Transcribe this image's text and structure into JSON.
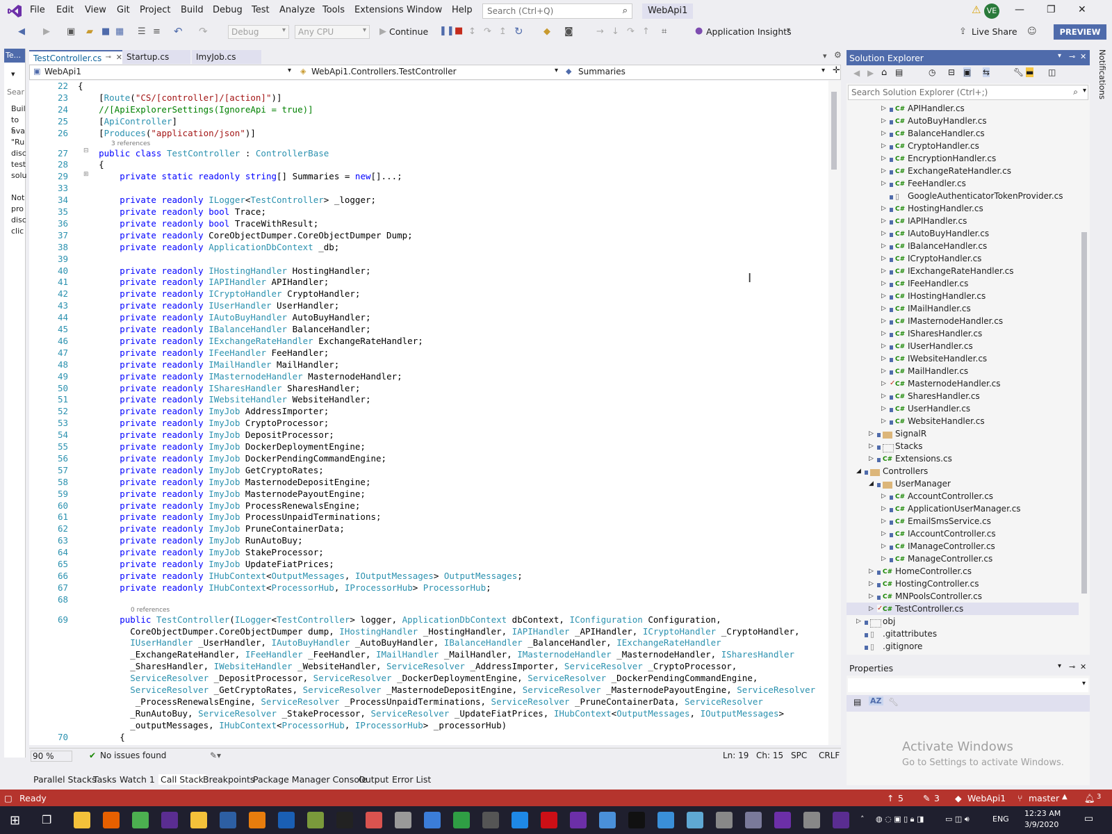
{
  "menu": [
    "File",
    "Edit",
    "View",
    "Git",
    "Project",
    "Build",
    "Debug",
    "Test",
    "Analyze",
    "Tools",
    "Extensions",
    "Window",
    "Help"
  ],
  "search_placeholder": "Search (Ctrl+Q)",
  "solution_title": "WebApi1",
  "avatar_initials": "VE",
  "toolbar": {
    "config": "Debug",
    "platform": "Any CPU",
    "continue_label": "Continue",
    "app_insights": "Application Insights",
    "live_share": "Live Share",
    "preview": "PREVIEW"
  },
  "left_pane": {
    "tab": "Te...",
    "search": "Sear",
    "lines": [
      "Buil",
      "to c",
      "ava",
      "\"Ru",
      "disc",
      "test",
      "solu",
      "",
      "Not",
      "pro",
      "disc",
      "clic"
    ]
  },
  "editor_tabs": [
    {
      "label": "TestController.cs",
      "active": true
    },
    {
      "label": "Startup.cs",
      "active": false
    },
    {
      "label": "ImyJob.cs",
      "active": false
    }
  ],
  "navbar": {
    "project": "WebApi1",
    "class": "WebApi1.Controllers.TestController",
    "member": "Summaries"
  },
  "code": [
    {
      "n": "22",
      "t": "{"
    },
    {
      "n": "23",
      "t": "    [Route(\"CS/[controller]/[action]\")]"
    },
    {
      "n": "24",
      "t": "    //[ApiExplorerSettings(IgnoreApi = true)]"
    },
    {
      "n": "25",
      "t": "    [ApiController]"
    },
    {
      "n": "26",
      "t": "    [Produces(\"application/json\")]"
    },
    {
      "n": "",
      "t": "",
      "ref": "3 references"
    },
    {
      "n": "27",
      "t": "    public class TestController : ControllerBase"
    },
    {
      "n": "28",
      "t": "    {"
    },
    {
      "n": "29",
      "t": "        private static readonly string[] Summaries = new[]...;"
    },
    {
      "n": "33",
      "t": ""
    },
    {
      "n": "34",
      "t": "        private readonly ILogger<TestController> _logger;"
    },
    {
      "n": "35",
      "t": "        private readonly bool Trace;"
    },
    {
      "n": "36",
      "t": "        private readonly bool TraceWithResult;"
    },
    {
      "n": "37",
      "t": "        private readonly CoreObjectDumper.CoreObjectDumper Dump;"
    },
    {
      "n": "38",
      "t": "        private readonly ApplicationDbContext _db;"
    },
    {
      "n": "39",
      "t": ""
    },
    {
      "n": "40",
      "t": "        private readonly IHostingHandler HostingHandler;"
    },
    {
      "n": "41",
      "t": "        private readonly IAPIHandler APIHandler;"
    },
    {
      "n": "42",
      "t": "        private readonly ICryptoHandler CryptoHandler;"
    },
    {
      "n": "43",
      "t": "        private readonly IUserHandler UserHandler;"
    },
    {
      "n": "44",
      "t": "        private readonly IAutoBuyHandler AutoBuyHandler;"
    },
    {
      "n": "45",
      "t": "        private readonly IBalanceHandler BalanceHandler;"
    },
    {
      "n": "46",
      "t": "        private readonly IExchangeRateHandler ExchangeRateHandler;"
    },
    {
      "n": "47",
      "t": "        private readonly IFeeHandler FeeHandler;"
    },
    {
      "n": "48",
      "t": "        private readonly IMailHandler MailHandler;"
    },
    {
      "n": "49",
      "t": "        private readonly IMasternodeHandler MasternodeHandler;"
    },
    {
      "n": "50",
      "t": "        private readonly ISharesHandler SharesHandler;"
    },
    {
      "n": "51",
      "t": "        private readonly IWebsiteHandler WebsiteHandler;"
    },
    {
      "n": "52",
      "t": "        private readonly ImyJob AddressImporter;"
    },
    {
      "n": "53",
      "t": "        private readonly ImyJob CryptoProcessor;"
    },
    {
      "n": "54",
      "t": "        private readonly ImyJob DepositProcessor;"
    },
    {
      "n": "55",
      "t": "        private readonly ImyJob DockerDeploymentEngine;"
    },
    {
      "n": "56",
      "t": "        private readonly ImyJob DockerPendingCommandEngine;"
    },
    {
      "n": "57",
      "t": "        private readonly ImyJob GetCryptoRates;"
    },
    {
      "n": "58",
      "t": "        private readonly ImyJob MasternodeDepositEngine;"
    },
    {
      "n": "59",
      "t": "        private readonly ImyJob MasternodePayoutEngine;"
    },
    {
      "n": "60",
      "t": "        private readonly ImyJob ProcessRenewalsEngine;"
    },
    {
      "n": "61",
      "t": "        private readonly ImyJob ProcessUnpaidTerminations;"
    },
    {
      "n": "62",
      "t": "        private readonly ImyJob PruneContainerData;"
    },
    {
      "n": "63",
      "t": "        private readonly ImyJob RunAutoBuy;"
    },
    {
      "n": "64",
      "t": "        private readonly ImyJob StakeProcessor;"
    },
    {
      "n": "65",
      "t": "        private readonly ImyJob UpdateFiatPrices;"
    },
    {
      "n": "66",
      "t": "        private readonly IHubContext<OutputMessages, IOutputMessages> OutputMessages;"
    },
    {
      "n": "67",
      "t": "        private readonly IHubContext<ProcessorHub, IProcessorHub> ProcessorHub;"
    },
    {
      "n": "68",
      "t": ""
    },
    {
      "n": "",
      "t": "",
      "ref": "0 references"
    },
    {
      "n": "69",
      "t": "        public TestController(ILogger<TestController> logger, ApplicationDbContext dbContext, IConfiguration Configuration,"
    },
    {
      "n": "",
      "t": "          CoreObjectDumper.CoreObjectDumper dump, IHostingHandler _HostingHandler, IAPIHandler _APIHandler, ICryptoHandler _CryptoHandler,"
    },
    {
      "n": "",
      "t": "          IUserHandler _UserHandler, IAutoBuyHandler _AutoBuyHandler, IBalanceHandler _BalanceHandler, IExchangeRateHandler"
    },
    {
      "n": "",
      "t": "          _ExchangeRateHandler, IFeeHandler _FeeHandler, IMailHandler _MailHandler, IMasternodeHandler _MasternodeHandler, ISharesHandler"
    },
    {
      "n": "",
      "t": "          _SharesHandler, IWebsiteHandler _WebsiteHandler, ServiceResolver _AddressImporter, ServiceResolver _CryptoProcessor,"
    },
    {
      "n": "",
      "t": "          ServiceResolver _DepositProcessor, ServiceResolver _DockerDeploymentEngine, ServiceResolver _DockerPendingCommandEngine,"
    },
    {
      "n": "",
      "t": "          ServiceResolver _GetCryptoRates, ServiceResolver _MasternodeDepositEngine, ServiceResolver _MasternodePayoutEngine, ServiceResolver"
    },
    {
      "n": "",
      "t": "           _ProcessRenewalsEngine, ServiceResolver _ProcessUnpaidTerminations, ServiceResolver _PruneContainerData, ServiceResolver"
    },
    {
      "n": "",
      "t": "          _RunAutoBuy, ServiceResolver _StakeProcessor, ServiceResolver _UpdateFiatPrices, IHubContext<OutputMessages, IOutputMessages>"
    },
    {
      "n": "",
      "t": "          _outputMessages, IHubContext<ProcessorHub, IProcessorHub> _processorHub)"
    },
    {
      "n": "70",
      "t": "        {"
    }
  ],
  "status_line": {
    "zoom": "90 %",
    "issues": "No issues found",
    "ln": "Ln: 19",
    "ch": "Ch: 15",
    "spc": "SPC",
    "crlf": "CRLF"
  },
  "bottom_tabs": [
    "Parallel Stacks",
    "Tasks",
    "Watch 1",
    "Call Stack",
    "Breakpoints",
    "Package Manager Console",
    "Output",
    "Error List"
  ],
  "bottom_active": "Call Stack",
  "status_bar": {
    "ready": "Ready",
    "up": "5",
    "pencil": "3",
    "repo": "WebApi1",
    "branch": "master",
    "notif_count": "3"
  },
  "solution_explorer": {
    "title": "Solution Explorer",
    "search": "Search Solution Explorer (Ctrl+;)",
    "items": [
      {
        "l": "APIHandler.cs",
        "d": 3,
        "cs": true,
        "exp": "r"
      },
      {
        "l": "AutoBuyHandler.cs",
        "d": 3,
        "cs": true,
        "exp": "r"
      },
      {
        "l": "BalanceHandler.cs",
        "d": 3,
        "cs": true,
        "exp": "r"
      },
      {
        "l": "CryptoHandler.cs",
        "d": 3,
        "cs": true,
        "exp": "r"
      },
      {
        "l": "EncryptionHandler.cs",
        "d": 3,
        "cs": true,
        "exp": "r"
      },
      {
        "l": "ExchangeRateHandler.cs",
        "d": 3,
        "cs": true,
        "exp": "r"
      },
      {
        "l": "FeeHandler.cs",
        "d": 3,
        "cs": true,
        "exp": "r"
      },
      {
        "l": "GoogleAuthenticatorTokenProvider.cs",
        "d": 3,
        "cs": false,
        "exp": ""
      },
      {
        "l": "HostingHandler.cs",
        "d": 3,
        "cs": true,
        "exp": "r"
      },
      {
        "l": "IAPIHandler.cs",
        "d": 3,
        "cs": true,
        "exp": "r"
      },
      {
        "l": "IAutoBuyHandler.cs",
        "d": 3,
        "cs": true,
        "exp": "r"
      },
      {
        "l": "IBalanceHandler.cs",
        "d": 3,
        "cs": true,
        "exp": "r"
      },
      {
        "l": "ICryptoHandler.cs",
        "d": 3,
        "cs": true,
        "exp": "r"
      },
      {
        "l": "IExchangeRateHandler.cs",
        "d": 3,
        "cs": true,
        "exp": "r"
      },
      {
        "l": "IFeeHandler.cs",
        "d": 3,
        "cs": true,
        "exp": "r"
      },
      {
        "l": "IHostingHandler.cs",
        "d": 3,
        "cs": true,
        "exp": "r"
      },
      {
        "l": "IMailHandler.cs",
        "d": 3,
        "cs": true,
        "exp": "r"
      },
      {
        "l": "IMasternodeHandler.cs",
        "d": 3,
        "cs": true,
        "exp": "r"
      },
      {
        "l": "ISharesHandler.cs",
        "d": 3,
        "cs": true,
        "exp": "r"
      },
      {
        "l": "IUserHandler.cs",
        "d": 3,
        "cs": true,
        "exp": "r"
      },
      {
        "l": "IWebsiteHandler.cs",
        "d": 3,
        "cs": true,
        "exp": "r"
      },
      {
        "l": "MailHandler.cs",
        "d": 3,
        "cs": true,
        "exp": "r"
      },
      {
        "l": "MasternodeHandler.cs",
        "d": 3,
        "cs": true,
        "exp": "r",
        "mod": true
      },
      {
        "l": "SharesHandler.cs",
        "d": 3,
        "cs": true,
        "exp": "r"
      },
      {
        "l": "UserHandler.cs",
        "d": 3,
        "cs": true,
        "exp": "r"
      },
      {
        "l": "WebsiteHandler.cs",
        "d": 3,
        "cs": true,
        "exp": "r"
      },
      {
        "l": "SignalR",
        "d": 2,
        "folder": true,
        "exp": "r"
      },
      {
        "l": "Stacks",
        "d": 2,
        "folder": true,
        "exp": "r",
        "ghost": true
      },
      {
        "l": "Extensions.cs",
        "d": 2,
        "cs": true,
        "exp": "r"
      },
      {
        "l": "Controllers",
        "d": 1,
        "folder": true,
        "exp": "d"
      },
      {
        "l": "UserManager",
        "d": 2,
        "folder": true,
        "exp": "d"
      },
      {
        "l": "AccountController.cs",
        "d": 3,
        "cs": true,
        "exp": "r"
      },
      {
        "l": "ApplicationUserManager.cs",
        "d": 3,
        "cs": true,
        "exp": "r"
      },
      {
        "l": "EmailSmsService.cs",
        "d": 3,
        "cs": true,
        "exp": "r"
      },
      {
        "l": "IAccountController.cs",
        "d": 3,
        "cs": true,
        "exp": "r"
      },
      {
        "l": "IManageController.cs",
        "d": 3,
        "cs": true,
        "exp": "r"
      },
      {
        "l": "ManageController.cs",
        "d": 3,
        "cs": true,
        "exp": "r"
      },
      {
        "l": "HomeController.cs",
        "d": 2,
        "cs": true,
        "exp": "r"
      },
      {
        "l": "HostingController.cs",
        "d": 2,
        "cs": true,
        "exp": "r"
      },
      {
        "l": "MNPoolsController.cs",
        "d": 2,
        "cs": true,
        "exp": "r"
      },
      {
        "l": "TestController.cs",
        "d": 2,
        "cs": true,
        "exp": "r",
        "mod": true,
        "sel": true
      },
      {
        "l": "obj",
        "d": 1,
        "folder": true,
        "exp": "r",
        "ghost": true
      },
      {
        "l": ".gitattributes",
        "d": 1,
        "file": true
      },
      {
        "l": ".gitignore",
        "d": 1,
        "file": true
      }
    ]
  },
  "properties": {
    "title": "Properties"
  },
  "notifications_label": "Notifications",
  "watermark": {
    "line1": "Activate Windows",
    "line2": "Go to Settings to activate Windows."
  },
  "clock": {
    "time": "12:23 AM",
    "date": "3/9/2020"
  },
  "lang": "ENG",
  "colors": {
    "accent": "#4f6bab",
    "status": "#b5342d",
    "taskbar": "#1f1f2e"
  }
}
